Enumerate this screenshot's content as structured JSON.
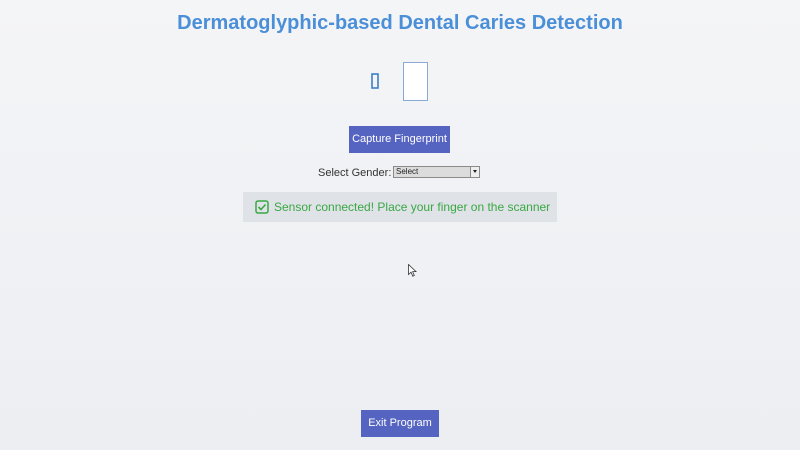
{
  "window": {
    "title": "Dermatoglyphic-based Dental Caries Detection"
  },
  "fingerprint": {
    "icon": "fingerprint-placeholder-icon",
    "preview": "fingerprint-preview-box"
  },
  "actions": {
    "capture_label": "Capture Fingerprint",
    "exit_label": "Exit Program"
  },
  "gender": {
    "label": "Select Gender:",
    "selected": "Select"
  },
  "status": {
    "icon": "check-square-icon",
    "text": "Sensor connected! Place your finger on the scanner"
  },
  "colors": {
    "title": "#4a8fd8",
    "button_bg": "#5563c1",
    "status_text": "#3aa845",
    "status_bg": "#dfe2e6"
  }
}
